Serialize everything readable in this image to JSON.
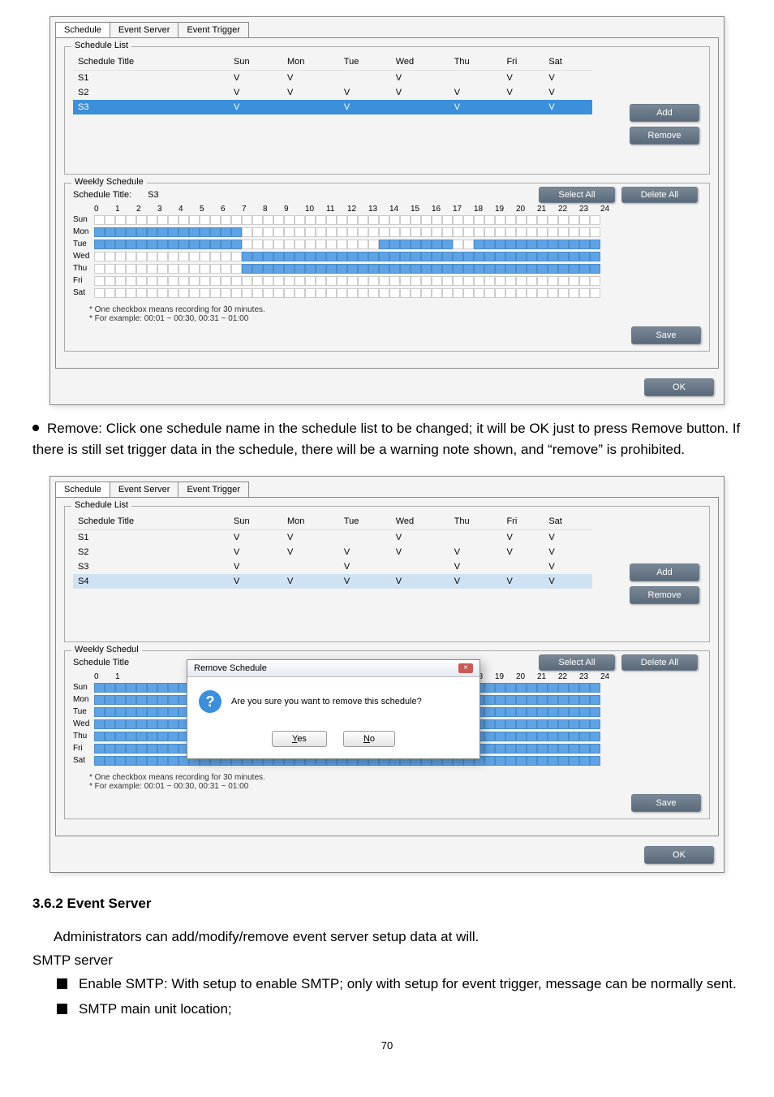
{
  "tabs": [
    "Schedule",
    "Event Server",
    "Event Trigger"
  ],
  "group_schedule_list": "Schedule List",
  "group_weekly": "Weekly Schedule",
  "headers": [
    "Schedule Title",
    "Sun",
    "Mon",
    "Tue",
    "Wed",
    "Thu",
    "Fri",
    "Sat"
  ],
  "dlg1_rows": [
    {
      "t": "S1",
      "v": [
        "V",
        "V",
        "",
        "V",
        "",
        "V",
        "V"
      ]
    },
    {
      "t": "S2",
      "v": [
        "V",
        "V",
        "V",
        "V",
        "V",
        "V",
        "V"
      ]
    },
    {
      "t": "S3",
      "v": [
        "V",
        "",
        "V",
        "",
        "V",
        "",
        "V"
      ],
      "sel": true
    }
  ],
  "btn_add": "Add",
  "btn_remove": "Remove",
  "btn_select_all": "Select All",
  "btn_delete_all": "Delete All",
  "btn_save": "Save",
  "btn_ok": "OK",
  "schedule_title_label": "Schedule Title:",
  "schedule_title_value": "S3",
  "days": [
    "Sun",
    "Mon",
    "Tue",
    "Wed",
    "Thu",
    "Fri",
    "Sat"
  ],
  "hours": [
    "0",
    "1",
    "2",
    "3",
    "4",
    "5",
    "6",
    "7",
    "8",
    "9",
    "10",
    "11",
    "12",
    "13",
    "14",
    "15",
    "16",
    "17",
    "18",
    "19",
    "20",
    "21",
    "22",
    "23",
    "24"
  ],
  "note1": "* One checkbox means recording for 30 minutes.",
  "note2": "* For example: 00:01 ~ 00:30, 00:31 ~ 01:00",
  "bullet_text": "Remove: Click one schedule name in the schedule list to be changed; it will be OK just to press Remove button. If there is still set trigger data in the schedule, there will be a warning note shown, and “remove” is prohibited.",
  "dlg2_rows": [
    {
      "t": "S1",
      "v": [
        "V",
        "V",
        "",
        "V",
        "",
        "V",
        "V"
      ]
    },
    {
      "t": "S2",
      "v": [
        "V",
        "V",
        "V",
        "V",
        "V",
        "V",
        "V"
      ]
    },
    {
      "t": "S3",
      "v": [
        "V",
        "",
        "V",
        "",
        "V",
        "",
        "V"
      ]
    },
    {
      "t": "S4",
      "v": [
        "V",
        "V",
        "V",
        "V",
        "V",
        "V",
        "V"
      ],
      "sel": true
    }
  ],
  "popup_title": "Remove Schedule",
  "popup_msg": "Are you sure you want to remove this schedule?",
  "popup_yes": "Yes",
  "popup_no": "No",
  "h3": "3.6.2 Event Server",
  "p1": "Administrators can add/modify/remove event server setup data at will.",
  "p2": "SMTP server",
  "sq1": "Enable SMTP: With setup to enable SMTP; only with setup for event trigger, message can be normally sent.",
  "sq2": "SMTP main unit location;",
  "page": "70",
  "dlg1_grid_days": {
    "Sun": [
      "off",
      "on48"
    ],
    "Mon": [
      "on14x",
      "on0",
      "off"
    ],
    "Tue": [
      "on14",
      "off13",
      "on7",
      "off",
      "on13"
    ],
    "Wed": [
      "off14",
      "on34"
    ],
    "Thu": [
      "off14",
      "on34"
    ],
    "Fri": [
      "on48"
    ],
    "Sat": [
      "on48"
    ]
  },
  "chart_data": {
    "type": "table",
    "title": "Weekly Schedule grid S3 (dialog 1) — 48 half-hour cells per day; true = selected",
    "categories": [
      "half-hour index 0..47"
    ],
    "series": [
      {
        "name": "Sun",
        "values": [
          false,
          false,
          false,
          false,
          false,
          false,
          false,
          false,
          false,
          false,
          false,
          false,
          false,
          false,
          false,
          false,
          false,
          false,
          false,
          false,
          false,
          false,
          false,
          false,
          false,
          false,
          false,
          false,
          false,
          false,
          false,
          false,
          false,
          false,
          false,
          false,
          false,
          false,
          false,
          false,
          false,
          false,
          false,
          false,
          false,
          false,
          false,
          false
        ]
      },
      {
        "name": "Mon",
        "values": [
          true,
          true,
          true,
          true,
          true,
          true,
          true,
          true,
          true,
          true,
          true,
          true,
          true,
          true,
          false,
          false,
          false,
          false,
          false,
          false,
          false,
          false,
          false,
          false,
          false,
          false,
          false,
          false,
          false,
          false,
          false,
          false,
          false,
          false,
          false,
          false,
          false,
          false,
          false,
          false,
          false,
          false,
          false,
          false,
          false,
          false,
          false,
          false
        ]
      },
      {
        "name": "Tue",
        "values": [
          true,
          true,
          true,
          true,
          true,
          true,
          true,
          true,
          true,
          true,
          true,
          true,
          true,
          true,
          false,
          false,
          false,
          false,
          false,
          false,
          false,
          false,
          false,
          false,
          false,
          false,
          false,
          true,
          true,
          true,
          true,
          true,
          true,
          true,
          false,
          false,
          true,
          true,
          true,
          true,
          true,
          true,
          true,
          true,
          true,
          true,
          true,
          true
        ]
      },
      {
        "name": "Wed",
        "values": [
          false,
          false,
          false,
          false,
          false,
          false,
          false,
          false,
          false,
          false,
          false,
          false,
          false,
          false,
          true,
          true,
          true,
          true,
          true,
          true,
          true,
          true,
          true,
          true,
          true,
          true,
          true,
          true,
          true,
          true,
          true,
          true,
          true,
          true,
          true,
          true,
          true,
          true,
          true,
          true,
          true,
          true,
          true,
          true,
          true,
          true,
          true,
          true
        ]
      },
      {
        "name": "Thu",
        "values": [
          false,
          false,
          false,
          false,
          false,
          false,
          false,
          false,
          false,
          false,
          false,
          false,
          false,
          false,
          true,
          true,
          true,
          true,
          true,
          true,
          true,
          true,
          true,
          true,
          true,
          true,
          true,
          true,
          true,
          true,
          true,
          true,
          true,
          true,
          true,
          true,
          true,
          true,
          true,
          true,
          true,
          true,
          true,
          true,
          true,
          true,
          true,
          true
        ]
      },
      {
        "name": "Fri",
        "values": [
          false,
          false,
          false,
          false,
          false,
          false,
          false,
          false,
          false,
          false,
          false,
          false,
          false,
          false,
          false,
          false,
          false,
          false,
          false,
          false,
          false,
          false,
          false,
          false,
          false,
          false,
          false,
          false,
          false,
          false,
          false,
          false,
          false,
          false,
          false,
          false,
          false,
          false,
          false,
          false,
          false,
          false,
          false,
          false,
          false,
          false,
          false,
          false
        ]
      },
      {
        "name": "Sat",
        "values": [
          false,
          false,
          false,
          false,
          false,
          false,
          false,
          false,
          false,
          false,
          false,
          false,
          false,
          false,
          false,
          false,
          false,
          false,
          false,
          false,
          false,
          false,
          false,
          false,
          false,
          false,
          false,
          false,
          false,
          false,
          false,
          false,
          false,
          false,
          false,
          false,
          false,
          false,
          false,
          false,
          false,
          false,
          false,
          false,
          false,
          false,
          false,
          false
        ]
      }
    ]
  }
}
